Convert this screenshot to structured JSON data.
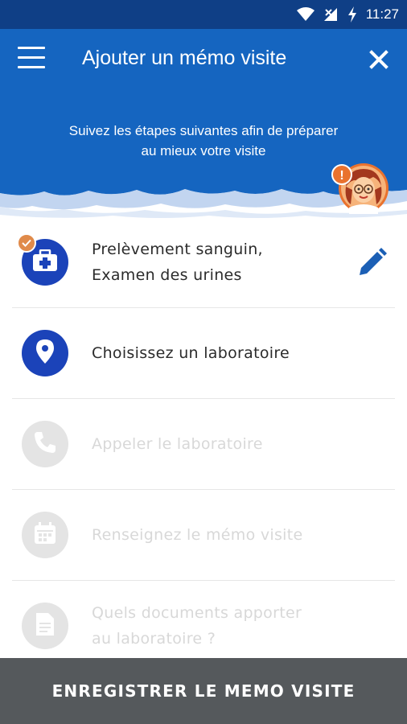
{
  "status_bar": {
    "time": "11:27",
    "icons": [
      "wifi-icon",
      "signal-icon",
      "battery-charging-icon"
    ]
  },
  "toolbar": {
    "title": "Ajouter un mémo visite",
    "menu_icon": "hamburger-menu-icon",
    "close_icon": "close-icon"
  },
  "banner": {
    "line1": "Suivez les étapes suivantes afin de préparer",
    "line2": "au mieux votre visite",
    "badge": "!"
  },
  "steps": [
    {
      "line1": "Prelèvement sanguin,",
      "line2": "Examen des urines",
      "icon": "medical-kit-icon",
      "state": "active",
      "completed": true,
      "editable": true
    },
    {
      "line1": "Choisissez un laboratoire",
      "icon": "location-pin-icon",
      "state": "active"
    },
    {
      "line1": "Appeler le laboratoire",
      "icon": "phone-icon",
      "state": "disabled"
    },
    {
      "line1": "Renseignez le mémo visite",
      "icon": "calendar-icon",
      "state": "disabled"
    },
    {
      "line1": "Quels documents apporter",
      "line2": "au laboratoire ?",
      "icon": "document-icon",
      "state": "disabled"
    }
  ],
  "save_button": {
    "label": "ENREGISTRER LE MEMO VISITE"
  },
  "colors": {
    "primary": "#1565c0",
    "status_bar": "#0f3f86",
    "step_active": "#1b43b9",
    "step_disabled": "#e4e4e4",
    "badge_orange": "#e08a4a",
    "button_bg": "#55595c"
  }
}
